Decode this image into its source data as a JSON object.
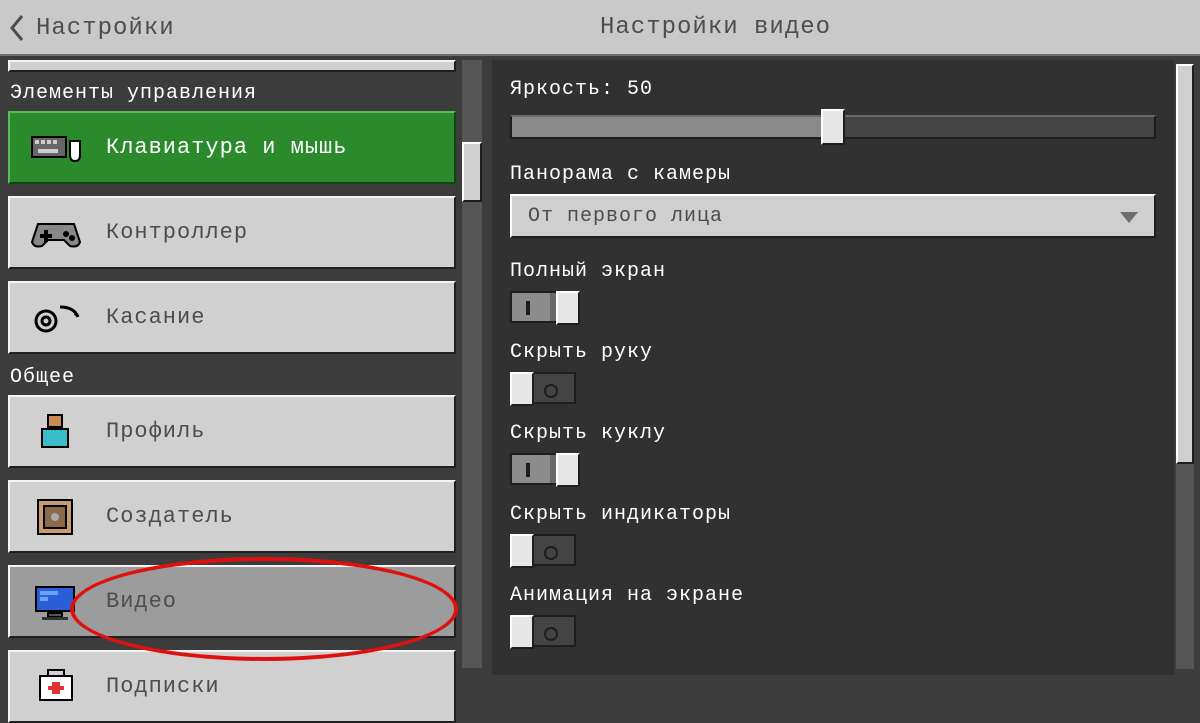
{
  "header": {
    "back_label": "Настройки",
    "title": "Настройки видео"
  },
  "sidebar": {
    "section_controls": "Элементы управления",
    "section_general": "Общее",
    "items": {
      "keyboard": "Клавиатура и мышь",
      "controller": "Контроллер",
      "touch": "Касание",
      "profile": "Профиль",
      "creator": "Создатель",
      "video": "Видео",
      "subscriptions": "Подписки"
    }
  },
  "panel": {
    "brightness_label": "Яркость: 50",
    "brightness_value": 50,
    "camera_label": "Панорама с камеры",
    "camera_value": "От первого лица",
    "fullscreen_label": "Полный экран",
    "fullscreen_value": true,
    "hide_hand_label": "Скрыть руку",
    "hide_hand_value": false,
    "hide_doll_label": "Скрыть куклу",
    "hide_doll_value": true,
    "hide_hud_label": "Скрыть индикаторы",
    "hide_hud_value": false,
    "screen_anim_label": "Анимация на экране",
    "screen_anim_value": false
  },
  "colors": {
    "accent_green": "#2b8a2b",
    "annotation_red": "#e11010"
  }
}
